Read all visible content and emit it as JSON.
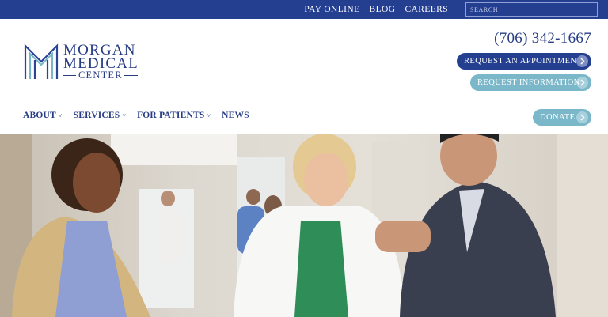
{
  "topbar": {
    "links": [
      "PAY ONLINE",
      "BLOG",
      "CAREERS"
    ],
    "search_placeholder": "SEARCH"
  },
  "logo": {
    "line1": "MORGAN",
    "line2": "MEDICAL",
    "line3": "CENTER",
    "icon": "m-monogram-icon"
  },
  "header": {
    "phone": "(706) 342-1667",
    "appointment_label": "REQUEST AN APPOINTMENT",
    "info_label": "REQUEST INFORMATION",
    "donate_label": "DONATE",
    "arrow_icon": "chevron-right-circle-icon"
  },
  "nav": {
    "items": [
      {
        "label": "ABOUT",
        "has_dropdown": true
      },
      {
        "label": "SERVICES",
        "has_dropdown": true
      },
      {
        "label": "FOR PATIENTS",
        "has_dropdown": true
      },
      {
        "label": "NEWS",
        "has_dropdown": false
      }
    ],
    "dropdown_glyph": "˅"
  },
  "colors": {
    "primary": "#253f90",
    "accent": "#7ab7c9",
    "text": "#273c84"
  }
}
